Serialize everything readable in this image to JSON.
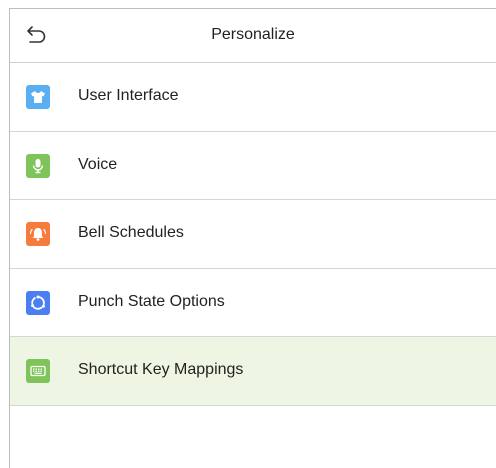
{
  "header": {
    "title": "Personalize",
    "back_icon": "back-arrow-icon"
  },
  "menu": {
    "items": [
      {
        "label": "User Interface",
        "icon": "tshirt-icon",
        "color": "#5aaef2"
      },
      {
        "label": "Voice",
        "icon": "microphone-icon",
        "color": "#7ec45a"
      },
      {
        "label": "Bell Schedules",
        "icon": "bell-icon",
        "color": "#f57c3c"
      },
      {
        "label": "Punch State Options",
        "icon": "punch-state-icon",
        "color": "#4b7ef0"
      },
      {
        "label": "Shortcut Key Mappings",
        "icon": "keyboard-icon",
        "color": "#7ec45a",
        "selected": true
      }
    ]
  },
  "colors": {
    "selected_row_bg": "#eef6e3",
    "divider": "#d6d6d6"
  }
}
